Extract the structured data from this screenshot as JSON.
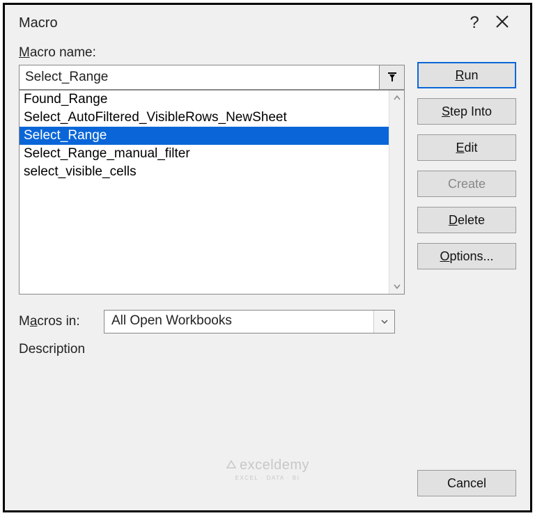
{
  "title": "Macro",
  "labels": {
    "macro_name": "Macro name:",
    "macros_in": "Macros in:",
    "description": "Description"
  },
  "macro_name_value": "Select_Range",
  "macros": [
    "Found_Range",
    "Select_AutoFiltered_VisibleRows_NewSheet",
    "Select_Range",
    "Select_Range_manual_filter",
    "select_visible_cells"
  ],
  "selected_macro_index": 2,
  "macros_in_value": "All Open Workbooks",
  "buttons": {
    "run": "Run",
    "step_into": "Step Into",
    "edit": "Edit",
    "create": "Create",
    "delete": "Delete",
    "options": "Options...",
    "cancel": "Cancel"
  },
  "watermark": {
    "name": "exceldemy",
    "sub": "EXCEL · DATA · BI"
  }
}
